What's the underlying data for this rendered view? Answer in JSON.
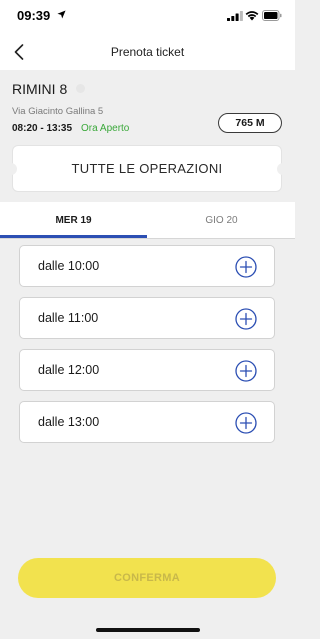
{
  "status_bar": {
    "time": "09:39"
  },
  "nav": {
    "title": "Prenota ticket"
  },
  "store": {
    "name": "RIMINI 8",
    "address": "Via Giacinto Gallina 5",
    "hours": "08:20 - 13:35",
    "status": "Ora Aperto",
    "distance": "765 M"
  },
  "operations_label": "TUTTE LE OPERAZIONI",
  "tabs": [
    {
      "label": "MER 19",
      "selected": true
    },
    {
      "label": "GIO 20",
      "selected": false
    }
  ],
  "slots": [
    {
      "label": "dalle 10:00"
    },
    {
      "label": "dalle 11:00"
    },
    {
      "label": "dalle 12:00"
    },
    {
      "label": "dalle 13:00"
    }
  ],
  "confirm_label": "CONFERMA",
  "colors": {
    "accent_blue": "#2c4fb3",
    "open_green": "#3aa83a",
    "confirm_yellow": "#f2e24e"
  }
}
